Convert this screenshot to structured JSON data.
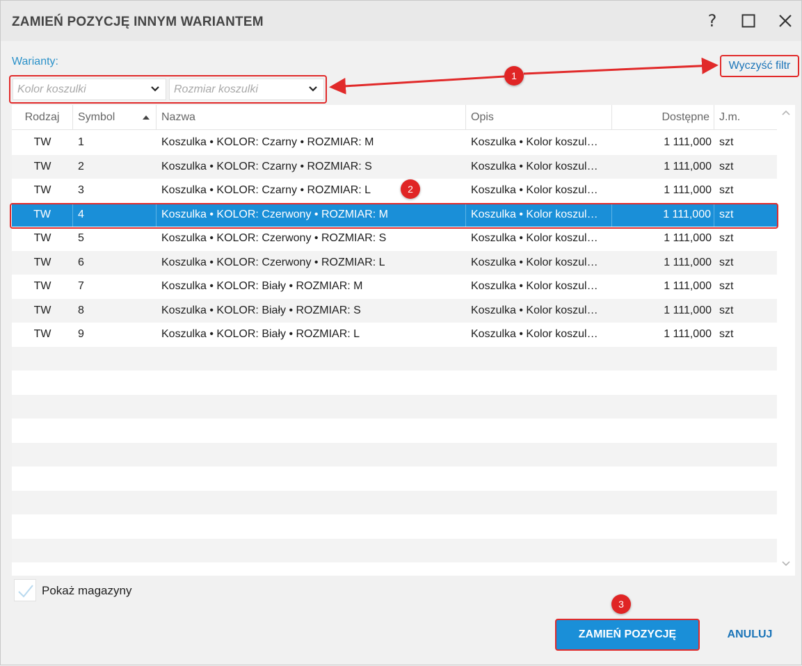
{
  "dialog": {
    "title": "ZAMIEŃ POZYCJĘ INNYM WARIANTEM",
    "help_label": "?"
  },
  "filters": {
    "label": "Warianty:",
    "clear_label": "Wyczyść filtr",
    "color_placeholder": "Kolor koszulki",
    "size_placeholder": "Rozmiar koszulki"
  },
  "grid": {
    "columns": [
      "Rodzaj",
      "Symbol",
      "Nazwa",
      "Opis",
      "Dostępne",
      "J.m."
    ],
    "sort_column": "Symbol",
    "rows": [
      {
        "rodzaj": "TW",
        "symbol": "1",
        "nazwa": "Koszulka • KOLOR: Czarny • ROZMIAR: M",
        "opis": "Koszulka • Kolor koszul…",
        "dostepne": "1 111,000",
        "jm": "szt"
      },
      {
        "rodzaj": "TW",
        "symbol": "2",
        "nazwa": "Koszulka • KOLOR: Czarny • ROZMIAR: S",
        "opis": "Koszulka • Kolor koszul…",
        "dostepne": "1 111,000",
        "jm": "szt"
      },
      {
        "rodzaj": "TW",
        "symbol": "3",
        "nazwa": "Koszulka • KOLOR: Czarny • ROZMIAR: L",
        "opis": "Koszulka • Kolor koszul…",
        "dostepne": "1 111,000",
        "jm": "szt"
      },
      {
        "rodzaj": "TW",
        "symbol": "4",
        "nazwa": "Koszulka • KOLOR: Czerwony • ROZMIAR: M",
        "opis": "Koszulka • Kolor koszul…",
        "dostepne": "1 111,000",
        "jm": "szt"
      },
      {
        "rodzaj": "TW",
        "symbol": "5",
        "nazwa": "Koszulka • KOLOR: Czerwony • ROZMIAR: S",
        "opis": "Koszulka • Kolor koszul…",
        "dostepne": "1 111,000",
        "jm": "szt"
      },
      {
        "rodzaj": "TW",
        "symbol": "6",
        "nazwa": "Koszulka • KOLOR: Czerwony • ROZMIAR: L",
        "opis": "Koszulka • Kolor koszul…",
        "dostepne": "1 111,000",
        "jm": "szt"
      },
      {
        "rodzaj": "TW",
        "symbol": "7",
        "nazwa": "Koszulka • KOLOR: Biały • ROZMIAR: M",
        "opis": "Koszulka • Kolor koszul…",
        "dostepne": "1 111,000",
        "jm": "szt"
      },
      {
        "rodzaj": "TW",
        "symbol": "8",
        "nazwa": "Koszulka • KOLOR: Biały • ROZMIAR: S",
        "opis": "Koszulka • Kolor koszul…",
        "dostepne": "1 111,000",
        "jm": "szt"
      },
      {
        "rodzaj": "TW",
        "symbol": "9",
        "nazwa": "Koszulka • KOLOR: Biały • ROZMIAR: L",
        "opis": "Koszulka • Kolor koszul…",
        "dostepne": "1 111,000",
        "jm": "szt"
      }
    ],
    "selected_index": 3,
    "empty_rows": 9
  },
  "footer": {
    "show_warehouses_label": "Pokaż magazyny",
    "show_warehouses_checked": false,
    "replace_button": "ZAMIEŃ POZYCJĘ",
    "cancel_button": "ANULUJ"
  },
  "annotations": {
    "badge_1": "1",
    "badge_2": "2",
    "badge_3": "3"
  },
  "colors": {
    "accent": "#1a8fd8",
    "link": "#1a74b8",
    "annotation": "#e12a2a"
  },
  "icons": [
    "help-icon",
    "maximize-icon",
    "close-icon",
    "chevron-down-icon",
    "sort-ascending-icon",
    "scroll-up-icon",
    "scroll-down-icon",
    "checkmark-icon"
  ]
}
